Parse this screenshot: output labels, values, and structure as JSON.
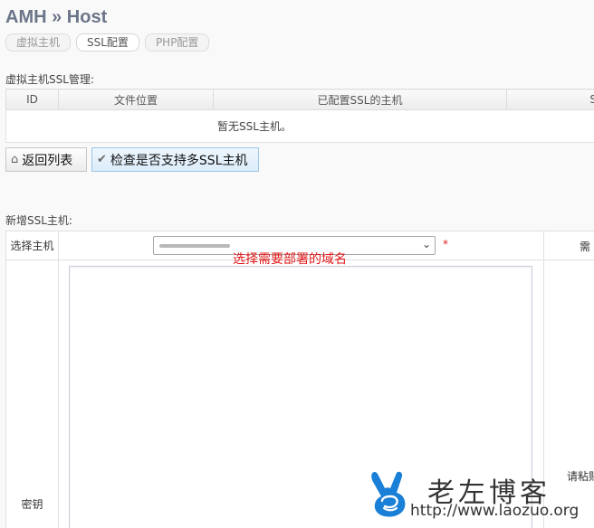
{
  "header": {
    "title": "AMH » Host"
  },
  "tabs": [
    {
      "label": "虚拟主机",
      "active": false
    },
    {
      "label": "SSL配置",
      "active": true
    },
    {
      "label": "PHP配置",
      "active": false
    }
  ],
  "ssl_list": {
    "section_label": "虚拟主机SSL管理:",
    "columns": [
      "ID",
      "文件位置",
      "已配置SSL的主机",
      "S"
    ],
    "empty_text": "暂无SSL主机。"
  },
  "buttons": {
    "back": {
      "label": "返回列表",
      "icon": "home-icon"
    },
    "check": {
      "label": "检查是否支持多SSL主机",
      "icon": "checkmark-icon"
    }
  },
  "new_ssl": {
    "section_label": "新增SSL主机:",
    "host_label": "选择主机",
    "host_required_mark": "*",
    "host_annotation": "选择需要部署的域名",
    "host_note_partial": "需",
    "key_label": "密钥",
    "key_note_partial": "请粘贴"
  },
  "watermark": {
    "text": "老左博客",
    "url": "http://www.laozuo.org",
    "color": "#1a7fd6"
  }
}
